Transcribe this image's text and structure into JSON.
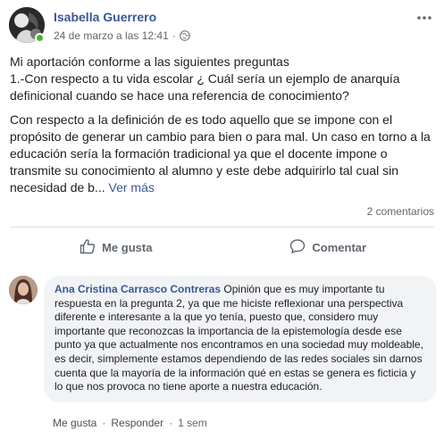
{
  "post": {
    "author": "Isabella Guerrero",
    "timestamp": "24 de marzo a las 12:41",
    "privacy_icon": "globe-icon",
    "paragraph1_line1": "Mi aportación conforme a las siguientes preguntas",
    "paragraph1_line2": "1.-Con respecto a tu vida escolar ¿ Cuál sería un ejemplo de anarquía definicional cuando se hace una referencia de conocimiento?",
    "paragraph2": "Con respecto a la definición de es todo aquello que se impone con el propósito de generar un cambio para bien o para mal. Un caso en torno a la educación sería la formación tradicional ya que el docente impone o transmite su conocimiento al alumno y este debe adquirirlo tal cual sin necesidad de b...",
    "see_more": "Ver más",
    "comments_count": "2 comentarios"
  },
  "actions": {
    "like": "Me gusta",
    "comment": "Comentar"
  },
  "comment": {
    "author": "Ana Cristina Carrasco Contreras",
    "text": "Opinión que es muy importante tu respuesta en la pregunta 2, ya que me hiciste reflexionar una perspectiva diferente e interesante a la que yo tenía, puesto que, considero muy importante que reconozcas la importancia de la epistemología desde ese punto ya que actualmente nos encontramos en una sociedad muy moldeable, es decir, simplemente estamos dependiendo de las redes sociales sin darnos cuenta que la mayoría de la información qué en estas se genera es ficticia y lo que nos provoca no tiene aporte a nuestra educación.",
    "like": "Me gusta",
    "reply": "Responder",
    "separator": "·",
    "age": "1 sem"
  },
  "colors": {
    "link": "#385898",
    "bubble": "#f2f3f5",
    "online": "#42b72a"
  }
}
